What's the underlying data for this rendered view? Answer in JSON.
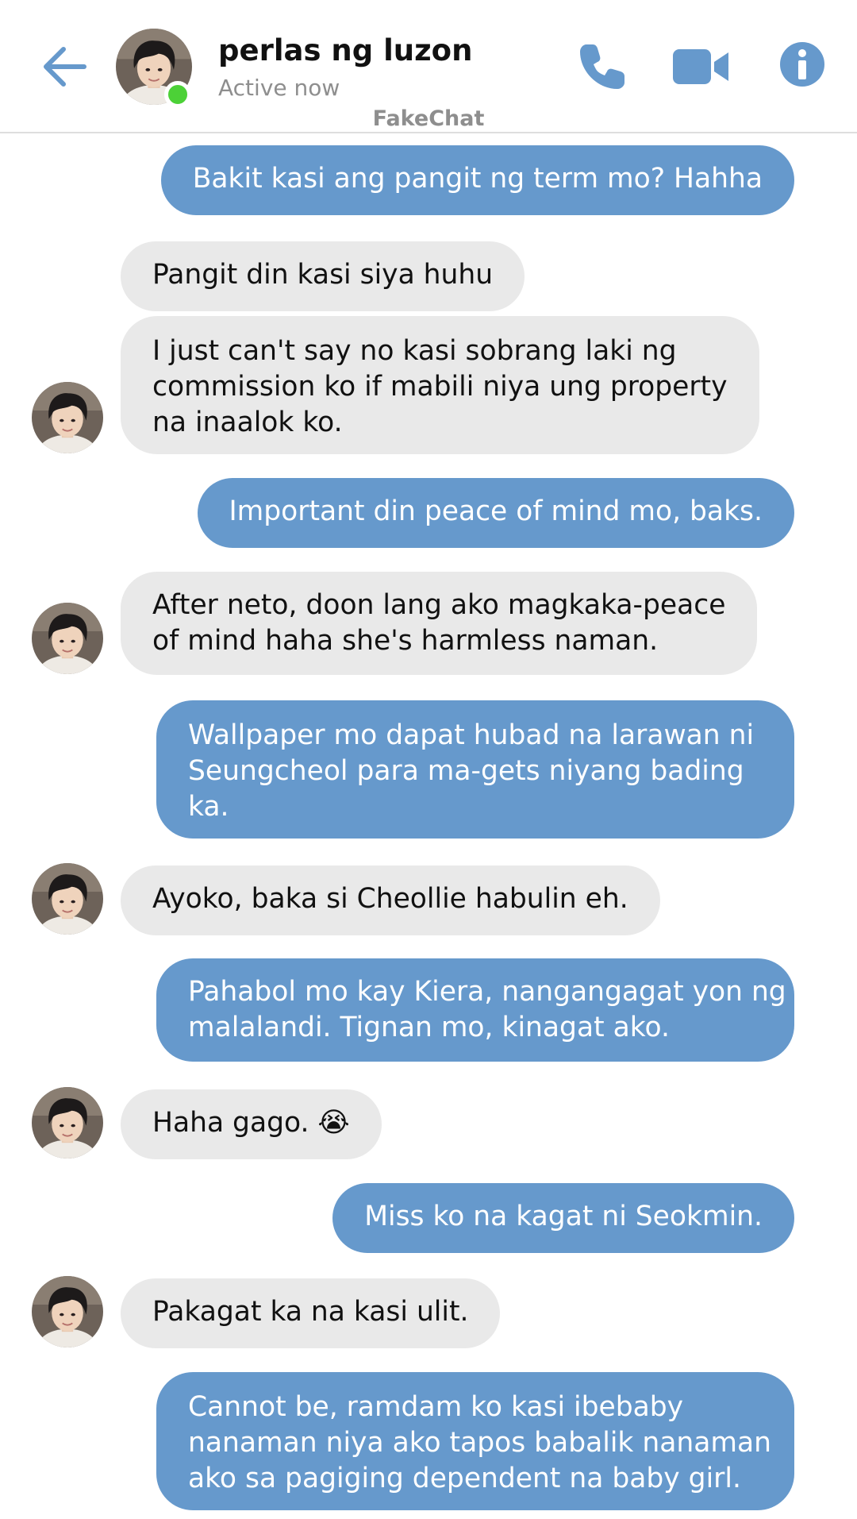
{
  "header": {
    "contact_name": "perlas ng luzon",
    "status": "Active now",
    "watermark": "FakeChat",
    "icons": [
      "back-arrow-icon",
      "phone-icon",
      "video-camera-icon",
      "info-icon"
    ],
    "accent_color": "#6699cc",
    "online_color": "#4cd137"
  },
  "messages": [
    {
      "from": "me",
      "lines": [
        "Bakit kasi ang pangit ng term mo? Hahha"
      ]
    },
    {
      "from": "them",
      "lines": [
        "Pangit din kasi siya huhu"
      ]
    },
    {
      "from": "them",
      "lines": [
        "I just can't say no kasi sobrang laki ng",
        "commission ko if mabili niya ung property",
        "na inaalok ko."
      ]
    },
    {
      "from": "me",
      "lines": [
        "Important din peace of mind mo, baks."
      ]
    },
    {
      "from": "them",
      "lines": [
        "After neto, doon lang ako magkaka-peace",
        "of mind haha she's harmless naman."
      ]
    },
    {
      "from": "me",
      "lines": [
        "Wallpaper mo dapat hubad na larawan ni",
        "Seungcheol para ma-gets niyang bading",
        "ka."
      ]
    },
    {
      "from": "them",
      "lines": [
        "Ayoko, baka si Cheollie habulin eh."
      ]
    },
    {
      "from": "me",
      "lines": [
        "Pahabol mo kay Kiera, nangangagat yon ng",
        "malalandi. Tignan mo, kinagat ako."
      ]
    },
    {
      "from": "them",
      "lines": [
        "Haha gago. 😭"
      ]
    },
    {
      "from": "me",
      "lines": [
        "Miss ko na kagat ni Seokmin."
      ]
    },
    {
      "from": "them",
      "lines": [
        "Pakagat ka na kasi ulit."
      ]
    },
    {
      "from": "me",
      "lines": [
        "Cannot be, ramdam ko kasi ibebaby",
        "nanaman niya ako tapos babalik nanaman",
        "ako sa pagiging dependent na baby girl."
      ]
    }
  ],
  "colors": {
    "sent_bubble": "#6699cc",
    "received_bubble": "#e9e9e9"
  }
}
